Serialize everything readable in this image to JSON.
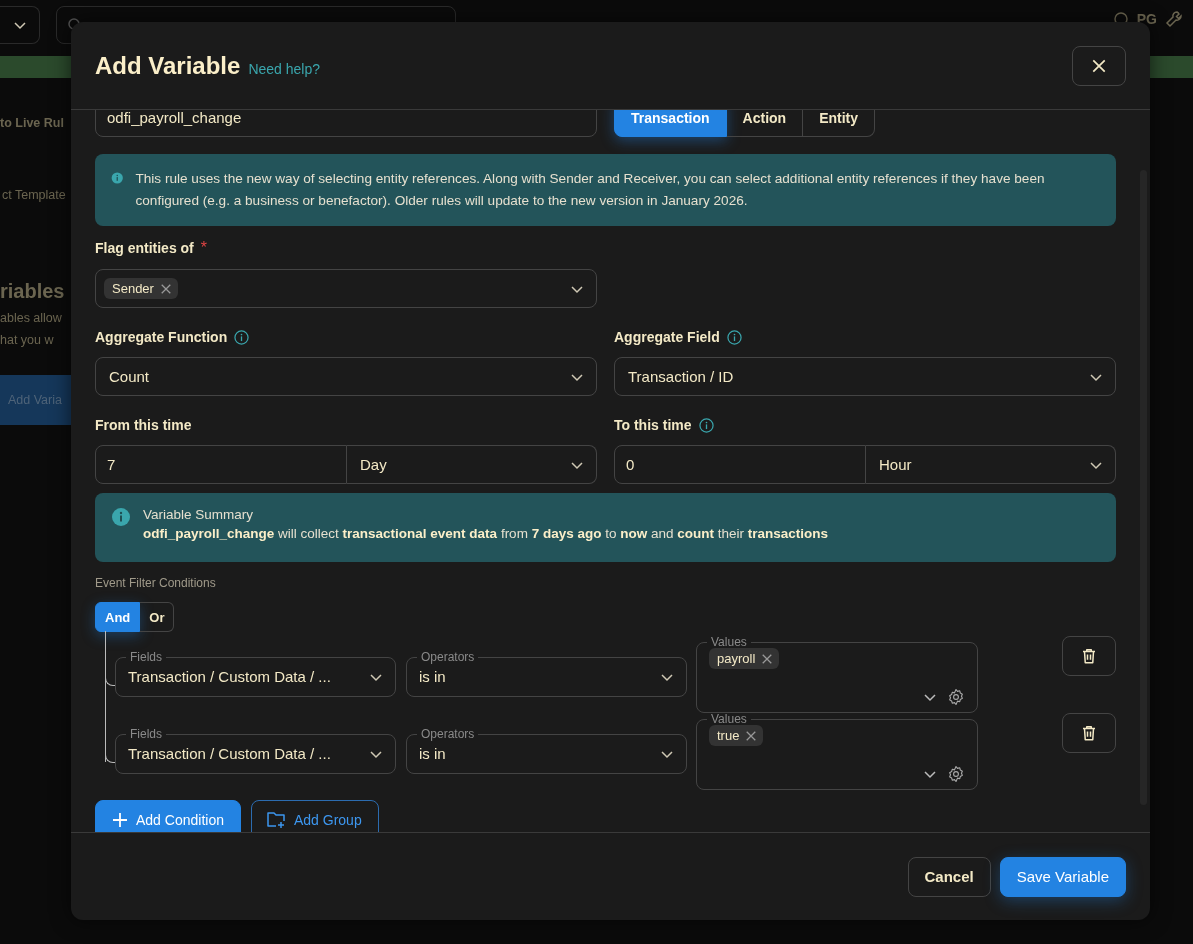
{
  "background": {
    "avatar_initials": "PG",
    "items": [
      {
        "kind": "link",
        "text": "to Live Rul"
      },
      {
        "kind": "row",
        "text": "ct Template"
      },
      {
        "kind": "heading",
        "text": "riables"
      },
      {
        "kind": "text",
        "text": "ables allow"
      },
      {
        "kind": "text",
        "text": "hat you w"
      },
      {
        "kind": "button",
        "text": "Add Varia"
      }
    ]
  },
  "modal": {
    "title": "Add Variable",
    "help_link": "Need help?",
    "name_field": {
      "value": "odfi_payroll_change"
    },
    "type_tabs": [
      {
        "label": "Transaction",
        "selected": true
      },
      {
        "label": "Action",
        "selected": false
      },
      {
        "label": "Entity",
        "selected": false
      }
    ],
    "notice": "This rule uses the new way of selecting entity references. Along with Sender and Receiver, you can select additional entity references if they have been configured (e.g. a business or benefactor). Older rules will update to the new version in January 2026.",
    "flag_entities": {
      "label": "Flag entities of",
      "required": true,
      "required_mark": "*",
      "chips": [
        "Sender"
      ]
    },
    "aggregate_function": {
      "label": "Aggregate Function",
      "info": true,
      "value": "Count"
    },
    "aggregate_field": {
      "label": "Aggregate Field",
      "info": true,
      "value": "Transaction / ID"
    },
    "from_time": {
      "label": "From this time",
      "info": false,
      "amount": "7",
      "unit": "Day"
    },
    "to_time": {
      "label": "To this time",
      "info": true,
      "amount": "0",
      "unit": "Hour"
    },
    "summary": {
      "title": "Variable Summary",
      "text": "**odfi_payroll_change** will collect **transactional event data** from **7 days ago** to **now** and **count** their **transactions**"
    },
    "filter": {
      "label": "Event Filter Conditions",
      "logic": [
        {
          "label": "And",
          "selected": true
        },
        {
          "label": "Or",
          "selected": false
        }
      ],
      "conditions": [
        {
          "field_label": "Fields",
          "field": "Transaction / Custom Data / ...",
          "operator_label": "Operators",
          "operator": "is in",
          "values_label": "Values",
          "values": [
            "payroll"
          ]
        },
        {
          "field_label": "Fields",
          "field": "Transaction / Custom Data / ...",
          "operator_label": "Operators",
          "operator": "is in",
          "values_label": "Values",
          "values": [
            "true"
          ]
        }
      ]
    },
    "actions": [
      "Add Condition",
      "Add Group"
    ],
    "footer": [
      "Cancel",
      "Save Variable"
    ]
  }
}
